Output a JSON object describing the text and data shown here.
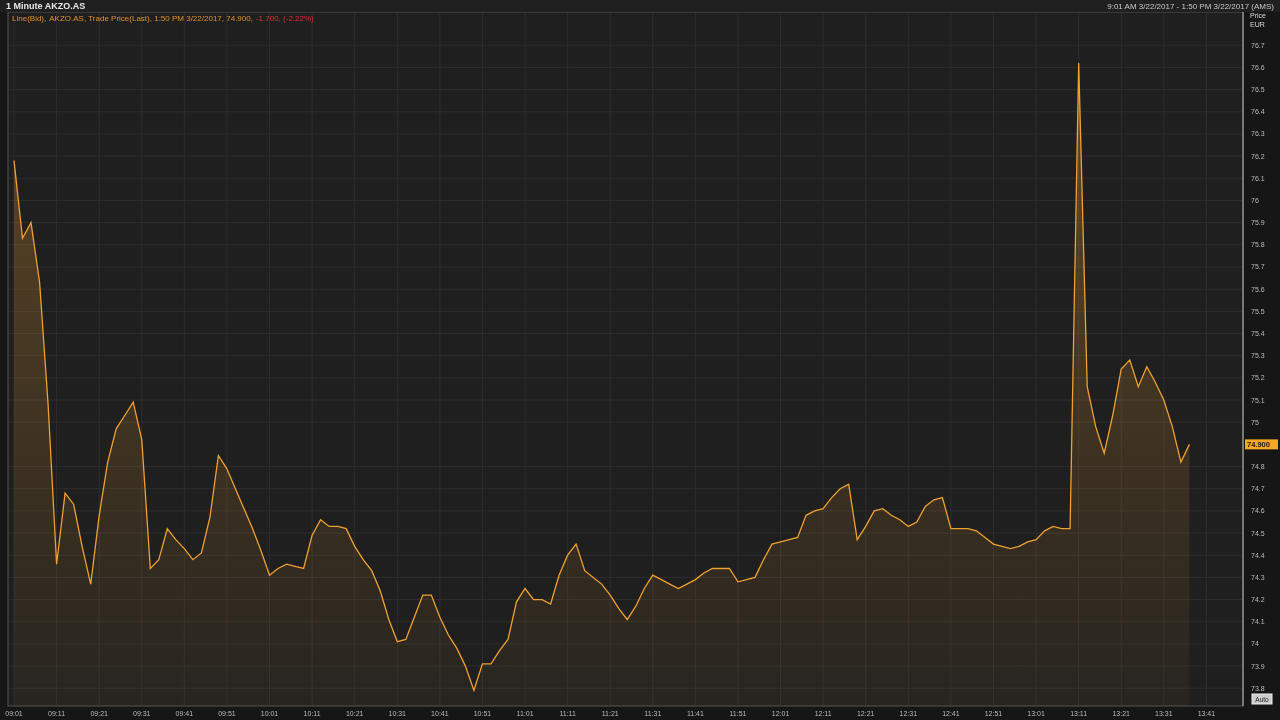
{
  "window": {
    "title": "1 Minute AKZO.AS",
    "range": "9:01 AM 3/22/2017 - 1:50 PM 3/22/2017 (AMS)"
  },
  "legend": {
    "label": "Line(Bid),",
    "text": ", Trade Price(Last), 1:50 PM 3/22/2017, 74.900,",
    "change": "-1.700, (-2.22%)"
  },
  "axis": {
    "title": "Price",
    "unit": "EUR"
  },
  "last_price": "74.900",
  "auto_button": "Auto",
  "chart_data": {
    "type": "area",
    "categories": [
      "09:01",
      null,
      null,
      null,
      null,
      "09:11",
      null,
      null,
      null,
      null,
      "09:21",
      null,
      null,
      null,
      null,
      "09:31",
      null,
      null,
      null,
      null,
      "09:41",
      null,
      null,
      null,
      null,
      "09:51",
      null,
      null,
      null,
      null,
      "10:01",
      null,
      null,
      null,
      null,
      "10:11",
      null,
      null,
      null,
      null,
      "10:21",
      null,
      null,
      null,
      null,
      "10:31",
      null,
      null,
      null,
      null,
      "10:41",
      null,
      null,
      null,
      null,
      "10:51",
      null,
      null,
      null,
      null,
      "11:01",
      null,
      null,
      null,
      null,
      "11:11",
      null,
      null,
      null,
      null,
      "11:21",
      null,
      null,
      null,
      null,
      "11:31",
      null,
      null,
      null,
      null,
      "11:41",
      null,
      null,
      null,
      null,
      "11:51",
      null,
      null,
      null,
      null,
      "12:01",
      null,
      null,
      null,
      null,
      "12:11",
      null,
      null,
      null,
      null,
      "12:21",
      null,
      null,
      null,
      null,
      "12:31",
      null,
      null,
      null,
      null,
      "12:41",
      null,
      null,
      null,
      null,
      "12:51",
      null,
      null,
      null,
      null,
      "13:01",
      null,
      null,
      null,
      null,
      "13:11",
      null,
      null,
      null,
      null,
      "13:21",
      null,
      null,
      null,
      null,
      "13:31",
      null,
      null,
      null,
      null,
      "13:41"
    ],
    "series": [
      {
        "name": "AKZO.AS",
        "color": "#f0a030",
        "values": [
          76.18,
          75.83,
          75.9,
          75.63,
          75.08,
          74.36,
          74.68,
          74.63,
          74.44,
          74.27,
          74.58,
          74.82,
          74.97,
          75.03,
          75.09,
          74.92,
          74.34,
          74.38,
          74.52,
          74.47,
          74.43,
          74.38,
          74.41,
          74.57,
          74.85,
          74.79,
          74.7,
          74.61,
          74.52,
          74.42,
          74.31,
          74.34,
          74.36,
          74.35,
          74.34,
          74.49,
          74.56,
          74.53,
          74.53,
          74.52,
          74.44,
          74.38,
          74.33,
          74.24,
          74.11,
          74.01,
          74.02,
          74.12,
          74.22,
          74.22,
          74.12,
          74.04,
          73.98,
          73.9,
          73.79,
          73.91,
          73.91,
          73.97,
          74.02,
          74.19,
          74.25,
          74.2,
          74.2,
          74.18,
          74.31,
          74.4,
          74.45,
          74.33,
          74.3,
          74.27,
          74.22,
          74.16,
          74.11,
          74.17,
          74.25,
          74.31,
          74.29,
          74.27,
          74.25,
          74.27,
          74.29,
          74.32,
          74.34,
          74.34,
          74.34,
          74.28,
          74.29,
          74.3,
          74.38,
          74.45,
          74.46,
          74.47,
          74.48,
          74.58,
          74.6,
          74.61,
          74.66,
          74.7,
          74.72,
          74.47,
          74.53,
          74.6,
          74.61,
          74.58,
          74.56,
          74.53,
          74.55,
          74.62,
          74.65,
          74.66,
          74.52,
          74.52,
          74.52,
          74.51,
          74.48,
          74.45,
          74.44,
          74.43,
          74.44,
          74.46,
          74.47,
          74.51,
          74.53,
          74.52,
          74.52,
          76.62,
          75.16,
          74.98,
          74.86,
          75.03,
          75.24,
          75.28,
          75.16,
          75.25,
          75.18,
          75.1,
          74.98,
          74.82,
          74.9,
          null,
          null
        ]
      }
    ],
    "yticks": [
      73.8,
      73.9,
      74,
      74.1,
      74.2,
      74.3,
      74.4,
      74.5,
      74.6,
      74.7,
      74.8,
      75,
      75.1,
      75.2,
      75.3,
      75.4,
      75.5,
      75.6,
      75.7,
      75.8,
      75.9,
      76,
      76.1,
      76.2,
      76.3,
      76.4,
      76.5,
      76.6,
      76.7
    ],
    "ylim": [
      73.72,
      76.85
    ],
    "grid": true
  }
}
